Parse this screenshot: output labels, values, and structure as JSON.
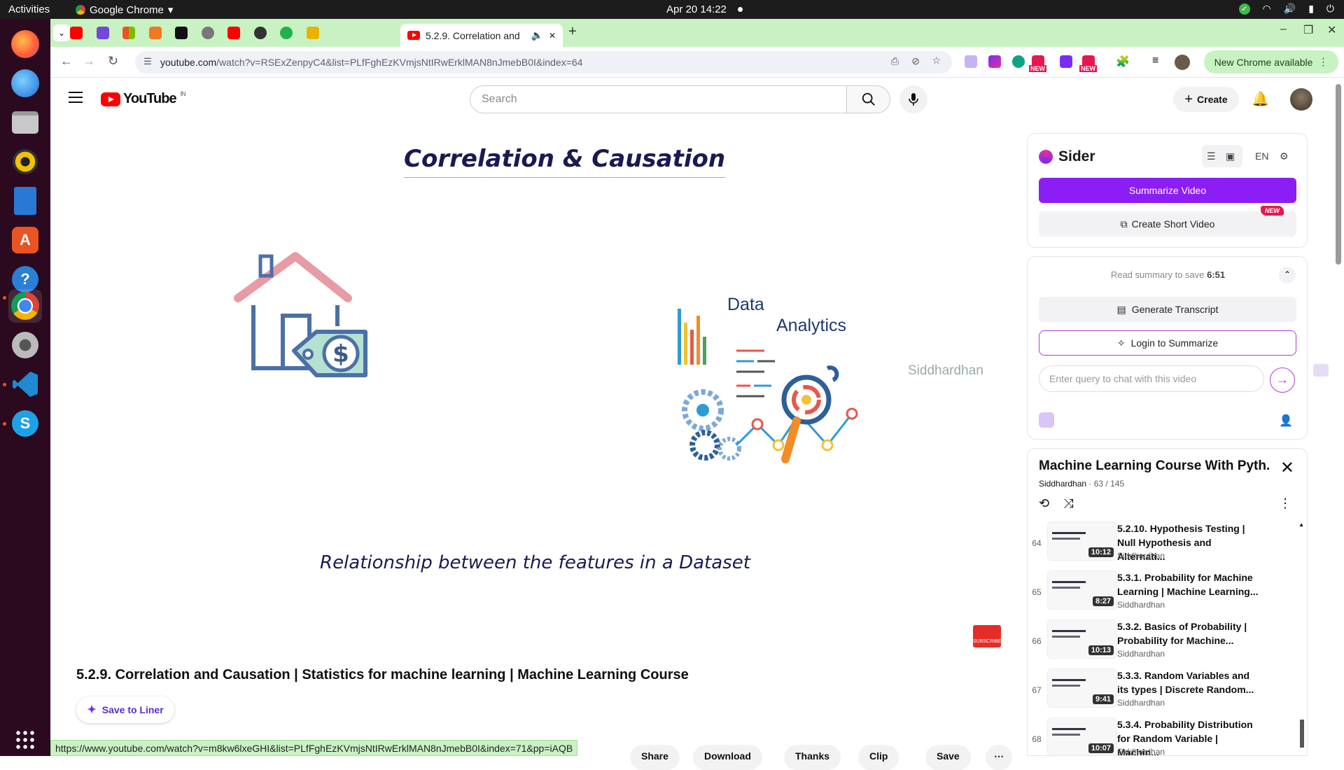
{
  "system": {
    "activities": "Activities",
    "app_name": "Google Chrome",
    "clock": "Apr 20  14:22"
  },
  "browser": {
    "active_tab_title": "5.2.9. Correlation and",
    "url_host": "youtube.com",
    "url_path": "/watch?v=RSExZenpyC4&list=PLfFghEzKVmjsNtIRwErklMAN8nJmebB0I&index=64",
    "new_chrome_label": "New Chrome available",
    "status_url": "https://www.youtube.com/watch?v=m8kw6lxeGHI&list=PLfFghEzKVmjsNtIRwErklMAN8nJmebB0I&index=71&pp=iAQB",
    "ext_badge_new": "NEW"
  },
  "youtube": {
    "logo_text": "YouTube",
    "region": "IN",
    "search_placeholder": "Search",
    "create_label": "Create"
  },
  "slide": {
    "title": "Correlation & Causation",
    "subtitle": "Relationship between the features in a Dataset",
    "data_word": "Data",
    "analytics_word": "Analytics",
    "watermark": "Siddhardhan",
    "subscribe": "SUBSCRIBE"
  },
  "video": {
    "title": "5.2.9. Correlation and Causation | Statistics for machine learning | Machine Learning Course",
    "save_to_liner": "Save to Liner",
    "actions": [
      "Share",
      "Download",
      "Thanks",
      "Clip",
      "Save"
    ]
  },
  "sider": {
    "brand": "Sider",
    "lang": "EN",
    "summarize_video": "Summarize Video",
    "create_short_video": "Create Short Video",
    "new_badge": "NEW",
    "read_summary_prefix": "Read summary to save",
    "read_summary_time": "6:51",
    "generate_transcript": "Generate Transcript",
    "login_to_summarize": "Login to Summarize",
    "chat_placeholder": "Enter query to chat with this video"
  },
  "playlist": {
    "title": "Machine Learning Course With Pyth...",
    "channel": "Siddhardhan",
    "position": "63 / 145",
    "items": [
      {
        "num": "64",
        "title": "5.2.10. Hypothesis Testing | Null Hypothesis and Alternati...",
        "channel": "Siddhardhan",
        "duration": "10:12"
      },
      {
        "num": "65",
        "title": "5.3.1. Probability for Machine Learning | Machine Learning...",
        "channel": "Siddhardhan",
        "duration": "8:27"
      },
      {
        "num": "66",
        "title": "5.3.2. Basics of Probability | Probability for Machine...",
        "channel": "Siddhardhan",
        "duration": "10:13"
      },
      {
        "num": "67",
        "title": "5.3.3. Random Variables and its types | Discrete Random...",
        "channel": "Siddhardhan",
        "duration": "9:41"
      },
      {
        "num": "68",
        "title": "5.3.4. Probability Distribution for Random Variable | Machin...",
        "channel": "Siddhardhan",
        "duration": "10:07"
      }
    ]
  }
}
